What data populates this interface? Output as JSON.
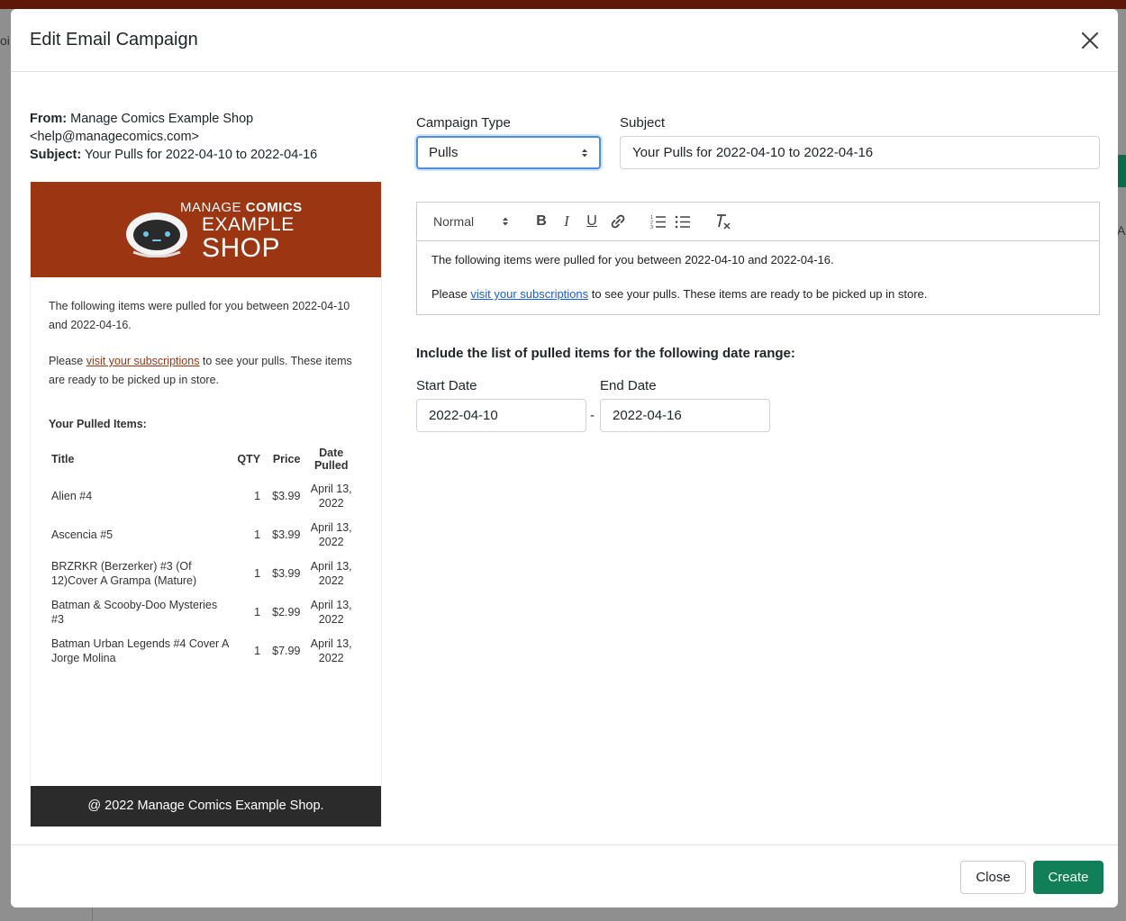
{
  "background": {
    "left_partial_text": "oi",
    "right_partial_text": "Ac"
  },
  "modal": {
    "title": "Edit Email Campaign"
  },
  "preview": {
    "from_label": "From:",
    "from_value": "Manage Comics Example Shop <help@managecomics.com>",
    "subject_label": "Subject:",
    "subject_value": "Your Pulls for 2022-04-10 to 2022-04-16",
    "logo": {
      "line1_regular": "MANAGE ",
      "line1_bold": "COMICS",
      "line2": "EXAMPLE",
      "line3": "SHOP"
    },
    "intro_text": "The following items were pulled for you between 2022-04-10 and 2022-04-16.",
    "visit_prefix": "Please ",
    "visit_link": "visit your subscriptions",
    "visit_suffix": " to see your pulls. These items are ready to be picked up in store.",
    "items_heading": "Your Pulled Items:",
    "table_headers": {
      "title": "Title",
      "qty": "QTY",
      "price": "Price",
      "date": "Date Pulled"
    },
    "items": [
      {
        "title": "Alien #4",
        "qty": "1",
        "price": "$3.99",
        "date": "April 13, 2022"
      },
      {
        "title": "Ascencia #5",
        "qty": "1",
        "price": "$3.99",
        "date": "April 13, 2022"
      },
      {
        "title": "BRZRKR (Berzerker) #3 (Of 12)Cover A Grampa (Mature)",
        "qty": "1",
        "price": "$3.99",
        "date": "April 13, 2022"
      },
      {
        "title": "Batman & Scooby-Doo Mysteries #3",
        "qty": "1",
        "price": "$2.99",
        "date": "April 13, 2022"
      },
      {
        "title": "Batman Urban Legends #4 Cover A Jorge Molina",
        "qty": "1",
        "price": "$7.99",
        "date": "April 13, 2022"
      }
    ],
    "footer": "@ 2022 Manage Comics Example Shop."
  },
  "form": {
    "campaign_type_label": "Campaign Type",
    "campaign_type_value": "Pulls",
    "subject_label": "Subject",
    "subject_value": "Your Pulls for 2022-04-10 to 2022-04-16",
    "editor": {
      "format_value": "Normal",
      "line1": "The following items were pulled for you between 2022-04-10 and 2022-04-16.",
      "line2_prefix": "Please ",
      "line2_link": "visit your subscriptions",
      "line2_suffix": " to see your pulls. These items are ready to be picked up in store.",
      "tools": [
        "bold-icon",
        "italic-icon",
        "underline-icon",
        "link-icon",
        "ordered-list-icon",
        "bullet-list-icon",
        "clear-format-icon"
      ]
    },
    "range_heading": "Include the list of pulled items for the following date range:",
    "start_date_label": "Start Date",
    "start_date_value": "2022-04-10",
    "range_separator": "-",
    "end_date_label": "End Date",
    "end_date_value": "2022-04-16"
  },
  "footer": {
    "close_label": "Close",
    "create_label": "Create"
  },
  "colors": {
    "brand": "#9b3512",
    "primary": "#118059",
    "focus": "#4a90e2",
    "link": "#1a5fd1"
  }
}
